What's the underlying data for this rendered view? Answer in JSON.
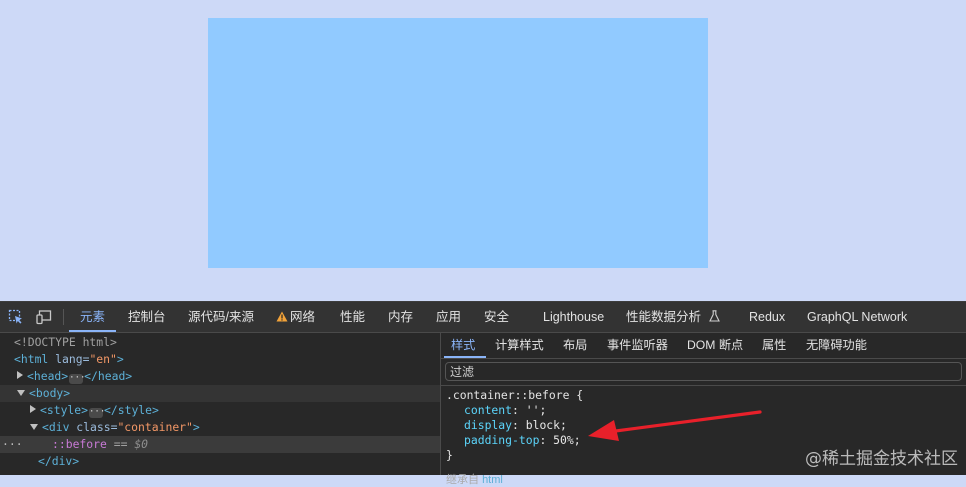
{
  "toolbar": {
    "tabs": [
      "元素",
      "控制台",
      "源代码/来源",
      "网络",
      "性能",
      "内存",
      "应用",
      "安全",
      "Lighthouse",
      "性能数据分析",
      "Redux",
      "GraphQL Network"
    ],
    "active_tab": "元素"
  },
  "dom_tree": {
    "doctype": "<!DOCTYPE html>",
    "html_open": "<html",
    "html_attr_name": " lang=",
    "html_attr_value": "\"en\"",
    "html_close_bracket": ">",
    "head_open": "<head>",
    "head_close": "</head>",
    "body_open": "<body>",
    "style_open": "<style>",
    "style_close": "</style>",
    "div_open": "<div",
    "div_attr_name": " class=",
    "div_attr_value": "\"container\"",
    "div_close_bracket": ">",
    "pseudo": "::before",
    "pseudo_eq": " == ",
    "pseudo_ref": "$0",
    "div_close": "</div>",
    "row_dots": "···",
    "ellipsis": "···"
  },
  "styles_pane": {
    "subtabs": [
      "样式",
      "计算样式",
      "布局",
      "事件监听器",
      "DOM 断点",
      "属性",
      "无障碍功能"
    ],
    "active_subtab": "样式",
    "filter_placeholder": "过滤",
    "rule": {
      "selector": ".container::before {",
      "declarations": [
        {
          "property": "content",
          "value": "'';"
        },
        {
          "property": "display",
          "value": "block;"
        },
        {
          "property": "padding-top",
          "value": "50%;"
        }
      ],
      "close": "}"
    },
    "inherited_label": "继承自",
    "inherited_tag": "html"
  },
  "watermark": "@稀土掘金技术社区",
  "colors": {
    "page_background": "#cdd9f7",
    "box_fill": "#91caff",
    "devtools_bg": "#282828",
    "accent": "#8ab4f8",
    "annotation_arrow": "#e8202a"
  }
}
